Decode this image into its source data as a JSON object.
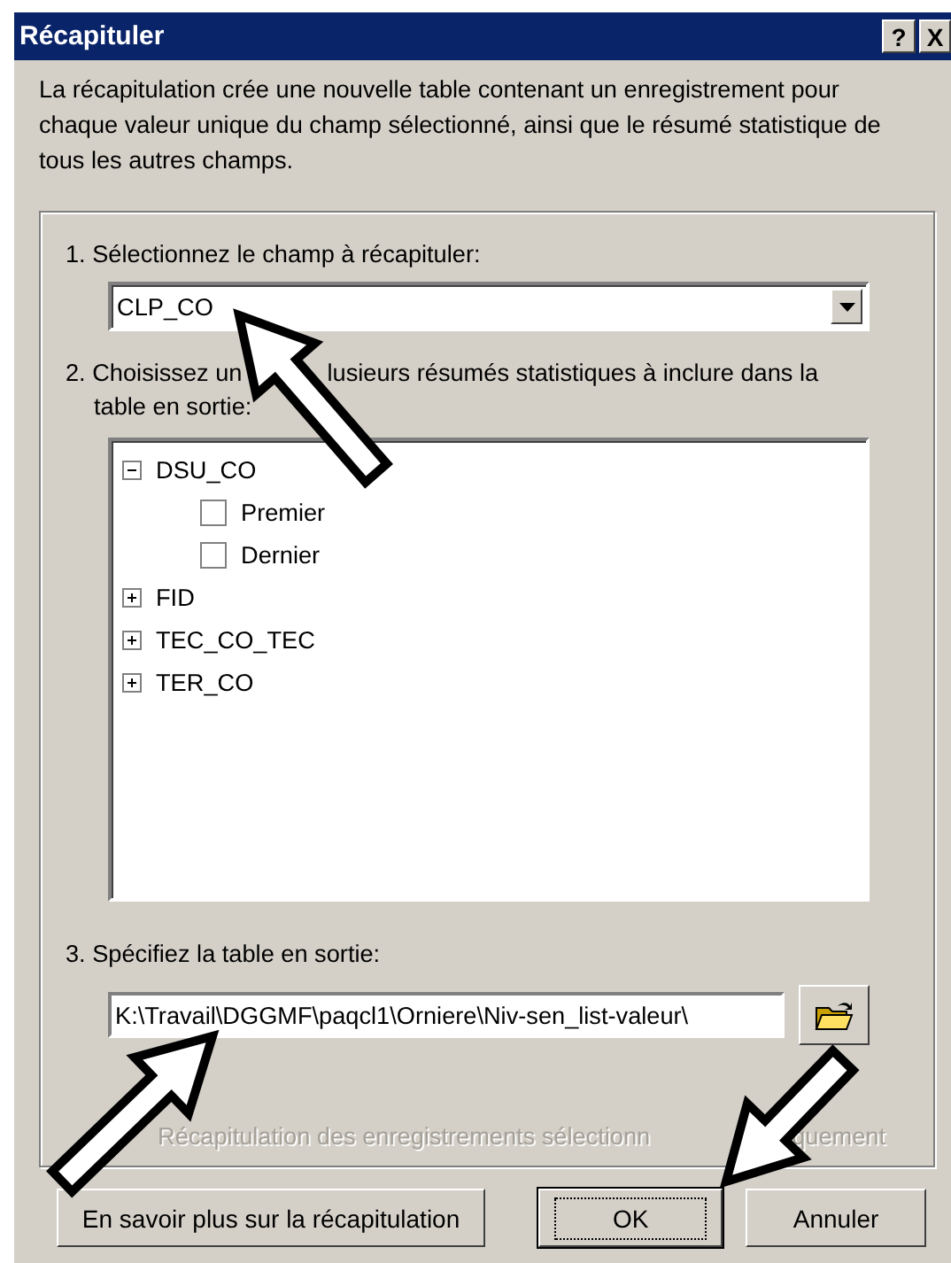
{
  "window": {
    "title": "Récapituler",
    "title_buttons": [
      {
        "kind": "help",
        "label": "?"
      },
      {
        "kind": "close",
        "label": "X"
      }
    ]
  },
  "description": "La récapitulation crée une nouvelle table contenant un enregistrement pour chaque valeur unique du champ sélectionné, ainsi que le résumé statistique de tous les autres champs.",
  "step1": {
    "label": "1. Sélectionnez le champ à récapituler:",
    "value": "CLP_CO"
  },
  "step2": {
    "label_parts": [
      "2. Choisissez un",
      "lusieurs résumés statistiques à inclure dans la",
      "table en sortie:"
    ],
    "tree": [
      {
        "label": "DSU_CO",
        "expanded": true,
        "children": [
          {
            "label": "Premier",
            "checked": false
          },
          {
            "label": "Dernier",
            "checked": false
          }
        ]
      },
      {
        "label": "FID",
        "expanded": false
      },
      {
        "label": "TEC_CO_TEC",
        "expanded": false
      },
      {
        "label": "TER_CO",
        "expanded": false
      }
    ]
  },
  "step3": {
    "label": "3. Spécifiez la table en sortie:",
    "value": "K:\\Travail\\DGGMF\\paqcl1\\Orniere\\Niv-sen_list-valeur\\"
  },
  "selected_only": {
    "label_parts": [
      "Récapitulation des enregistrements sélectionn",
      "quement"
    ],
    "disabled": true
  },
  "buttons": [
    {
      "label": "En savoir plus sur la récapitulation",
      "default": false
    },
    {
      "label": "OK",
      "default": true
    },
    {
      "label": "Annuler",
      "default": false
    }
  ]
}
